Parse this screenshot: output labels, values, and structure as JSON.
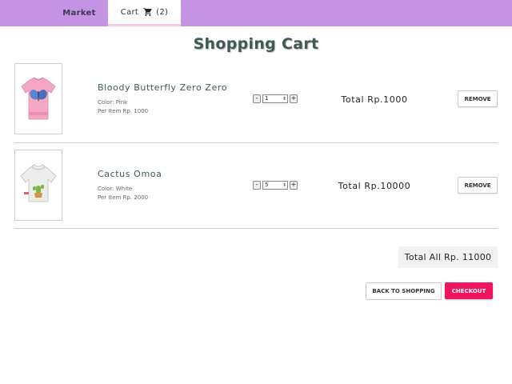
{
  "nav": {
    "market_label": "Market",
    "cart_label": "Cart",
    "cart_count": "(2)",
    "accent_color": "#c493e3"
  },
  "page": {
    "title": "Shopping Cart"
  },
  "items": [
    {
      "name": "Bloody Butterfly Zero Zero",
      "color": "Color: Pink",
      "per_item": "Per Item Rp. 1000",
      "quantity": "1",
      "total": "Total Rp.1000",
      "remove_label": "REMOVE",
      "shirt_color": "#f4a7c4"
    },
    {
      "name": "Cactus Omoa",
      "color": "Color: White",
      "per_item": "Per Item Rp. 2000",
      "quantity": "5",
      "total": "Total Rp.10000",
      "remove_label": "REMOVE",
      "shirt_color": "#ececec"
    }
  ],
  "summary": {
    "total_all": "Total All Rp. 11000",
    "back_label": "BACK TO SHOPPING",
    "checkout_label": "CHECKOUT",
    "checkout_color": "#f0145f"
  }
}
